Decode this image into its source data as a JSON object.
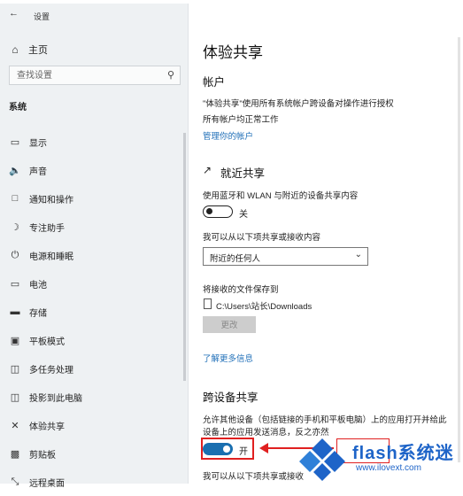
{
  "window": {
    "title": "设置"
  },
  "sidebar": {
    "home_label": "主页",
    "search_placeholder": "查找设置",
    "section_label": "系统",
    "items": [
      {
        "label": "显示",
        "icon": "monitor-icon"
      },
      {
        "label": "声音",
        "icon": "speaker-icon"
      },
      {
        "label": "通知和操作",
        "icon": "notification-icon"
      },
      {
        "label": "专注助手",
        "icon": "moon-icon"
      },
      {
        "label": "电源和睡眠",
        "icon": "power-icon"
      },
      {
        "label": "电池",
        "icon": "battery-icon"
      },
      {
        "label": "存储",
        "icon": "storage-icon"
      },
      {
        "label": "平板模式",
        "icon": "tablet-icon"
      },
      {
        "label": "多任务处理",
        "icon": "multitask-icon"
      },
      {
        "label": "投影到此电脑",
        "icon": "project-icon"
      },
      {
        "label": "体验共享",
        "icon": "shared-experiences-icon"
      },
      {
        "label": "剪贴板",
        "icon": "clipboard-icon"
      },
      {
        "label": "远程桌面",
        "icon": "remote-desktop-icon"
      }
    ],
    "active_item": "体验共享"
  },
  "main": {
    "title": "体验共享",
    "accounts": {
      "heading": "帐户",
      "line1": "\"体验共享\"使用所有系统帐户跨设备对操作进行授权",
      "line2": "所有帐户均正常工作",
      "link": "管理你的帐户"
    },
    "nearby": {
      "heading": "就近共享",
      "desc": "使用蓝牙和 WLAN 与附近的设备共享内容",
      "toggle_state": "关",
      "receive_label": "我可以从以下项共享或接收内容",
      "receive_value": "附近的任何人",
      "save_label": "将接收的文件保存到",
      "save_path": "C:\\Users\\站长\\Downloads",
      "change_button": "更改",
      "learn_more": "了解更多信息"
    },
    "cross_device": {
      "heading": "跨设备共享",
      "desc1": "允许其他设备（包括链接的手机和平板电脑）上的应用打开并给此",
      "desc2": "设备上的应用发送消息，反之亦然",
      "toggle_state": "开",
      "receive_label": "我可以从以下项共享或接收"
    }
  },
  "watermark": {
    "text": "flash系统迷",
    "url": "www.ilovext.com"
  },
  "colors": {
    "accent": "#1a6fb0",
    "link": "#1f6fb8",
    "annotation": "#e02020"
  }
}
